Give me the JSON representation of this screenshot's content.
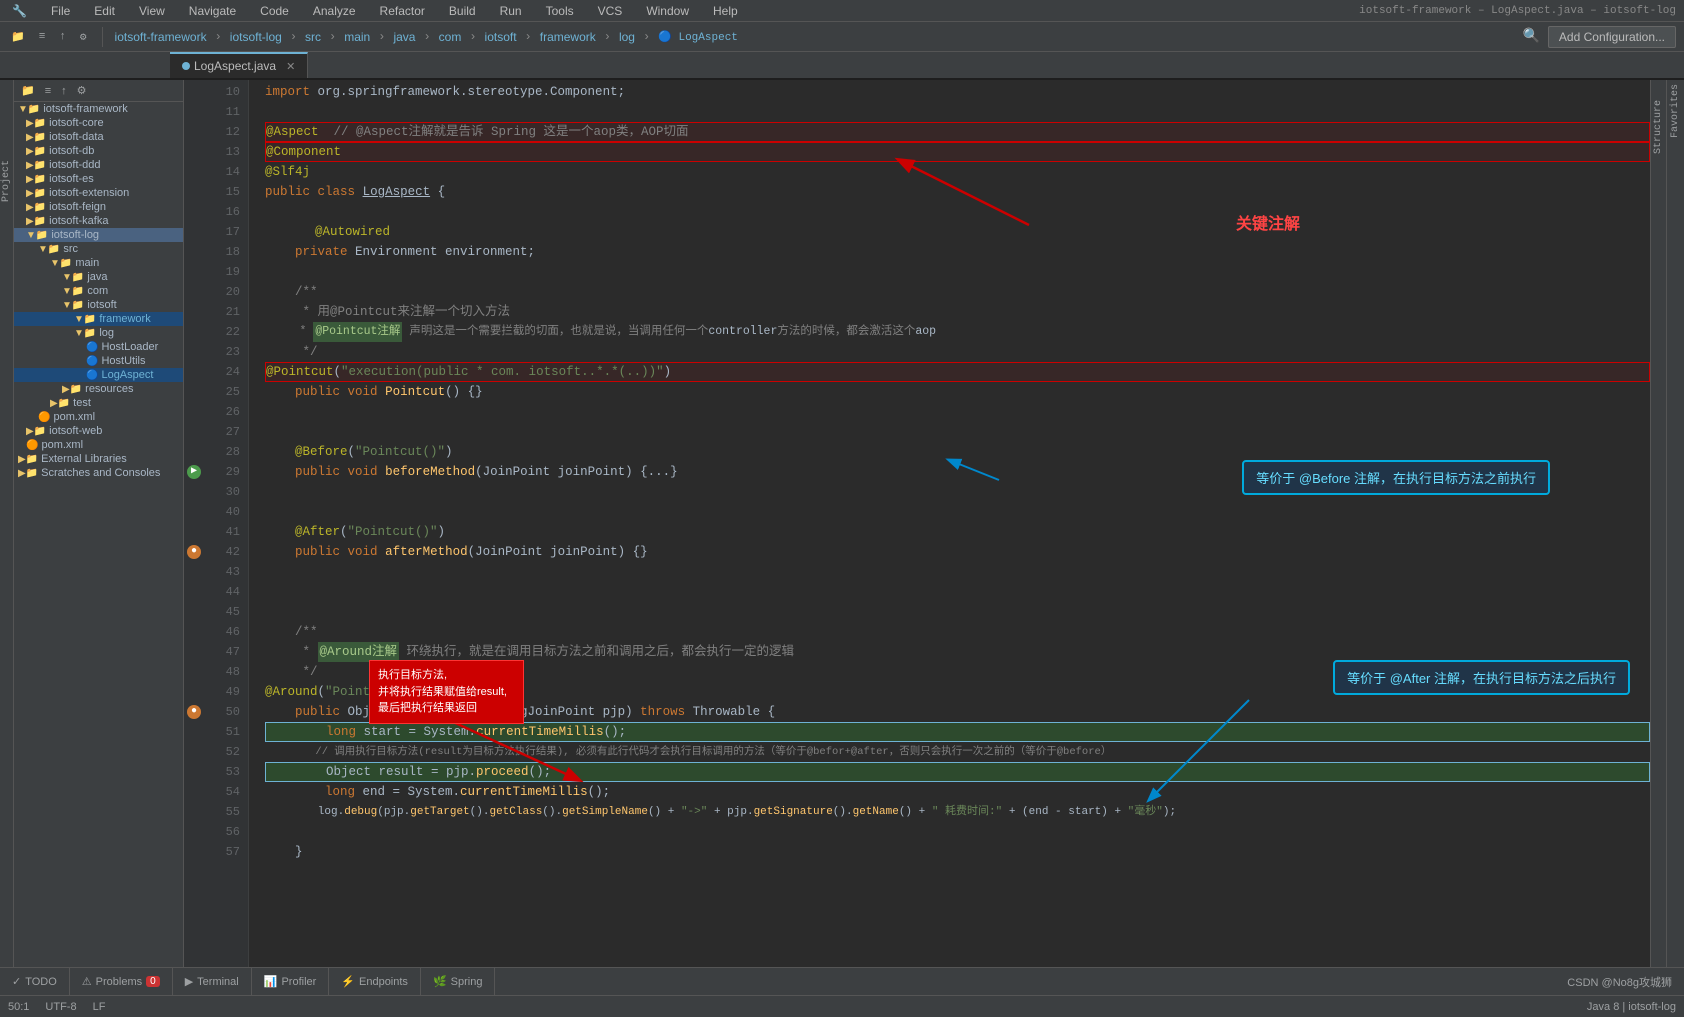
{
  "menuBar": {
    "items": [
      "iotsoft-framework",
      "File",
      "Edit",
      "View",
      "Navigate",
      "Code",
      "Analyze",
      "Refactor",
      "Build",
      "Run",
      "Tools",
      "VCS",
      "Window",
      "Help"
    ],
    "breadcrumb": "iotsoft-framework – LogAspect.java – iotsoft-log"
  },
  "toolbar": {
    "breadcrumbs": [
      "iotsoft-framework",
      "iotsoft-log",
      "src",
      "main",
      "java",
      "com",
      "iotsoft",
      "framework",
      "log",
      "LogAspect"
    ],
    "addConfig": "Add Configuration..."
  },
  "tabs": [
    {
      "label": "LogAspect.java",
      "active": true
    }
  ],
  "sidebar": {
    "projectLabel": "Project",
    "items": [
      {
        "label": "iotsoft-framework",
        "indent": 0,
        "type": "folder",
        "expanded": true
      },
      {
        "label": "iotsoft-core",
        "indent": 1,
        "type": "folder"
      },
      {
        "label": "iotsoft-data",
        "indent": 1,
        "type": "folder"
      },
      {
        "label": "iotsoft-db",
        "indent": 1,
        "type": "folder"
      },
      {
        "label": "iotsoft-ddd",
        "indent": 1,
        "type": "folder"
      },
      {
        "label": "iotsoft-es",
        "indent": 1,
        "type": "folder"
      },
      {
        "label": "iotsoft-extension",
        "indent": 1,
        "type": "folder"
      },
      {
        "label": "iotsoft-feign",
        "indent": 1,
        "type": "folder"
      },
      {
        "label": "iotsoft-kafka",
        "indent": 1,
        "type": "folder"
      },
      {
        "label": "iotsoft-log",
        "indent": 1,
        "type": "folder",
        "expanded": true,
        "selected": true
      },
      {
        "label": "src",
        "indent": 2,
        "type": "folder",
        "expanded": true
      },
      {
        "label": "main",
        "indent": 3,
        "type": "folder",
        "expanded": true
      },
      {
        "label": "java",
        "indent": 4,
        "type": "folder",
        "expanded": true
      },
      {
        "label": "com",
        "indent": 5,
        "type": "folder",
        "expanded": true
      },
      {
        "label": "iotsoft",
        "indent": 5,
        "type": "folder",
        "expanded": true
      },
      {
        "label": "framework",
        "indent": 5,
        "type": "folder",
        "expanded": true,
        "active": true
      },
      {
        "label": "log",
        "indent": 6,
        "type": "folder",
        "expanded": true
      },
      {
        "label": "HostLoader",
        "indent": 7,
        "type": "java"
      },
      {
        "label": "HostUtils",
        "indent": 7,
        "type": "java"
      },
      {
        "label": "LogAspect",
        "indent": 7,
        "type": "java",
        "active": true
      },
      {
        "label": "resources",
        "indent": 4,
        "type": "folder"
      },
      {
        "label": "test",
        "indent": 3,
        "type": "folder"
      },
      {
        "label": "pom.xml",
        "indent": 2,
        "type": "xml"
      },
      {
        "label": "iotsoft-web",
        "indent": 1,
        "type": "folder"
      },
      {
        "label": "pom.xml",
        "indent": 1,
        "type": "xml"
      },
      {
        "label": "External Libraries",
        "indent": 0,
        "type": "folder"
      },
      {
        "label": "Scratches and Consoles",
        "indent": 0,
        "type": "folder"
      }
    ]
  },
  "codeLines": [
    {
      "num": 10,
      "content": "    import org.springframework.stereotype.Component;"
    },
    {
      "num": 11,
      "content": ""
    },
    {
      "num": 12,
      "content": "@Aspect  // @Aspect注解就是告诉 Spring 这是一个aop类，AOP切面",
      "annotation": true,
      "boxed": true
    },
    {
      "num": 13,
      "content": "@Component",
      "annotation": true
    },
    {
      "num": 14,
      "content": "@Slf4j"
    },
    {
      "num": 15,
      "content": "public class LogAspect {"
    },
    {
      "num": 16,
      "content": ""
    },
    {
      "num": 17,
      "content": "    @Autowired"
    },
    {
      "num": 18,
      "content": "    private Environment environment;"
    },
    {
      "num": 19,
      "content": ""
    },
    {
      "num": 20,
      "content": "    /**"
    },
    {
      "num": 21,
      "content": "     * 用@Pointcut来注解一个切入方法"
    },
    {
      "num": 22,
      "content": "     * @Pointcut注解 声明这是一个需要拦截的切面，也就是说，当调用任何一个controller方法的时候，都会激活这个aop"
    },
    {
      "num": 23,
      "content": "     */"
    },
    {
      "num": 24,
      "content": "@Pointcut(\"execution(public * com. iotsoft..*.*(..))\")",
      "boxed": true
    },
    {
      "num": 25,
      "content": "    public void Pointcut() {}"
    },
    {
      "num": 26,
      "content": ""
    },
    {
      "num": 27,
      "content": ""
    },
    {
      "num": 28,
      "content": "    @Before(\"Pointcut()\")"
    },
    {
      "num": 29,
      "content": "    public void beforeMethod(JoinPoint joinPoint) {...}"
    },
    {
      "num": 30,
      "content": ""
    },
    {
      "num": 40,
      "content": ""
    },
    {
      "num": 41,
      "content": "    @After(\"Pointcut()\")"
    },
    {
      "num": 42,
      "content": "    public void afterMethod(JoinPoint joinPoint) {}"
    },
    {
      "num": 43,
      "content": ""
    },
    {
      "num": 44,
      "content": ""
    },
    {
      "num": 45,
      "content": ""
    },
    {
      "num": 46,
      "content": "    /**"
    },
    {
      "num": 47,
      "content": "     * @Around注解 环绕执行，就是在调用目标方法之前和调用之后，都会执行一定的逻辑"
    },
    {
      "num": 48,
      "content": "     */"
    },
    {
      "num": 49,
      "content": "@Around(\"Pointcut()\")"
    },
    {
      "num": 50,
      "content": "    public Object Around(ProceedingJoinPoint pjp) throws Throwable {"
    },
    {
      "num": 51,
      "content": "        long start = System.currentTimeMillis();",
      "highlighted": true
    },
    {
      "num": 52,
      "content": "        // 调用执行目标方法(result为目标方法执行结果), 必须有此行代码才会执行目标调用的方法（等价于@befor+@after，否则只会执行一次之前的（等价于@before）"
    },
    {
      "num": 53,
      "content": "        Object result = pjp.proceed();",
      "highlighted": true
    },
    {
      "num": 54,
      "content": "        long end = System.currentTimeMillis();"
    },
    {
      "num": 55,
      "content": "        log.debug(pjp.getTarget().getClass().getSimpleName() + \"->\" + pjp.getSignature().getName() + \" 耗费时间:\" + (end - start) + \"毫秒\");"
    },
    {
      "num": 56,
      "content": ""
    },
    {
      "num": 57,
      "content": "    }"
    }
  ],
  "callouts": {
    "redTop": "关键注解",
    "blueMiddle": "等价于 @Before 注解，在执行目标方法之前执行",
    "blueRight": "等价于 @After 注解，在执行目标方法之后执行",
    "leftBox": "执行目标方法,\n并将执行结果赋值给result,\n最后把执行结果返回"
  },
  "bottomTabs": [
    {
      "label": "TODO",
      "icon": "✓"
    },
    {
      "label": "Problems",
      "icon": "⚠",
      "badge": "0"
    },
    {
      "label": "Terminal",
      "icon": "▶"
    },
    {
      "label": "Profiler",
      "icon": "📊"
    },
    {
      "label": "Endpoints",
      "icon": "→"
    },
    {
      "label": "Spring",
      "icon": "🌿"
    }
  ],
  "statusBar": {
    "right": "CSDN @No8g攻城狮"
  }
}
